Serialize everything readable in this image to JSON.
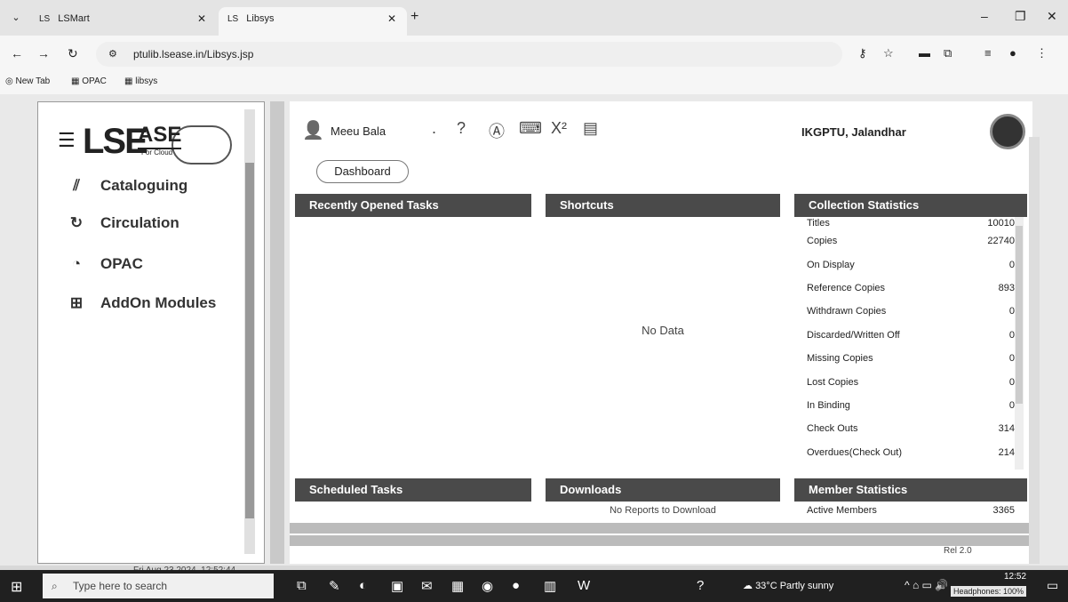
{
  "browser": {
    "tabs": [
      {
        "favicon": "LS",
        "label": "LSMart"
      },
      {
        "favicon": "LS",
        "label": "Libsys"
      }
    ],
    "url": "ptulib.lsease.in/Libsys.jsp",
    "bookmarks": [
      "New Tab",
      "OPAC",
      "libsys"
    ]
  },
  "sidebar": {
    "logo": {
      "main": "LSE",
      "ase": "ASE",
      "sub": "For Cloud"
    },
    "items": [
      {
        "label": "Cataloguing",
        "icon": "cataloguing-icon"
      },
      {
        "label": "Circulation",
        "icon": "circulation-icon"
      },
      {
        "label": "OPAC",
        "icon": "opac-icon"
      },
      {
        "label": "AddOn Modules",
        "icon": "addon-icon"
      }
    ],
    "datetime": "Fri Aug 23 2024, 12:52:44"
  },
  "header": {
    "user_name": "Meeu Bala",
    "dot": ".",
    "org": "IKGPTU, Jalandhar",
    "dashboard_label": "Dashboard"
  },
  "panels": {
    "recent": {
      "title": "Recently Opened Tasks"
    },
    "shortcuts": {
      "title": "Shortcuts",
      "empty": "No Data"
    },
    "collection": {
      "title": "Collection Statistics",
      "rows": [
        {
          "label": "Titles",
          "value": "10010"
        },
        {
          "label": "Copies",
          "value": "22740"
        },
        {
          "label": "On Display",
          "value": "0"
        },
        {
          "label": "Reference Copies",
          "value": "893"
        },
        {
          "label": "Withdrawn Copies",
          "value": "0"
        },
        {
          "label": "Discarded/Written Off",
          "value": "0"
        },
        {
          "label": "Missing Copies",
          "value": "0"
        },
        {
          "label": "Lost Copies",
          "value": "0"
        },
        {
          "label": "In Binding",
          "value": "0"
        },
        {
          "label": "Check Outs",
          "value": "314"
        },
        {
          "label": "Overdues(Check Out)",
          "value": "214"
        }
      ]
    },
    "scheduled": {
      "title": "Scheduled Tasks"
    },
    "downloads": {
      "title": "Downloads",
      "empty": "No Reports to Download"
    },
    "members": {
      "title": "Member Statistics",
      "row_label": "Active Members",
      "row_value": "3365"
    }
  },
  "release": "Rel 2.0",
  "taskbar": {
    "search_placeholder": "Type here to search",
    "weather": "33°C Partly sunny",
    "time": "12:52",
    "headphones": "Headphones: 100%"
  }
}
